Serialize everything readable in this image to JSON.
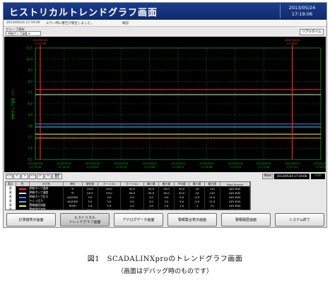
{
  "window": {
    "title": "ヒストリカルトレンドグラフ画面",
    "date": "2013/05/24",
    "time": "17:19:06"
  },
  "message_bar": {
    "timestamp": "2013/05/24 17:19:06",
    "message": "エラー時に警告が発生しました。",
    "status": "確認"
  },
  "selector": {
    "label": "グループ選択",
    "value": "供給ポンプ温度",
    "realtime_button": "リアルタイム"
  },
  "chart_data": {
    "type": "line",
    "title": "",
    "y_axis_label": "供給ポンプ温度（℃）",
    "y_ticks": [
      "11.5",
      "10.4",
      "9.3",
      "8.2",
      "7.1",
      "6.0",
      "4.9",
      "3.8",
      "2.7",
      "1.6",
      "0.5"
    ],
    "x_ticks": [
      {
        "date": "2013/05/24",
        "time": "17:14:08"
      },
      {
        "date": "2013/05/24",
        "time": "17:14:33"
      },
      {
        "date": "2013/05/24",
        "time": "17:14:58"
      },
      {
        "date": "2013/05/24",
        "time": "17:15:23"
      },
      {
        "date": "2013/05/24",
        "time": "17:15:48"
      },
      {
        "date": "2013/05/24",
        "time": "17:16:13"
      },
      {
        "date": "2013/05/24",
        "time": "17:16:38"
      },
      {
        "date": "2013/05/24",
        "time": "17:17:03"
      },
      {
        "date": "2013/05/24",
        "time": "17:17:28"
      },
      {
        "date": "2013/05/24",
        "time": "17:17:53"
      },
      {
        "date": "2013/05/24",
        "time": "17:18:18"
      }
    ],
    "cursor_labels": [
      {
        "date": "2013/05/24",
        "time": "17:14:08"
      },
      {
        "date": "2013/05/24",
        "time": "17:18:22"
      }
    ],
    "series": [
      {
        "color": "#ff3030",
        "value": 7.4
      },
      {
        "color": "#e8e8e8",
        "value": 6.9
      },
      {
        "color": "#7070ff",
        "value": 4.0
      },
      {
        "color": "#ffff30",
        "value": 3.0
      },
      {
        "color": "#30c8ff",
        "value": 3.7
      },
      {
        "color": "#ff8c00",
        "value": 2.6
      }
    ],
    "ylim": [
      0.5,
      11.5
    ],
    "grid": true,
    "cursors": [
      0.0,
      0.9
    ]
  },
  "nav": {
    "buttons": [
      "<<",
      "<",
      ">",
      ">>",
      "|<",
      ">|",
      "最新\n表示"
    ],
    "now_label": "Now",
    "now_value": "2013/05/24 17:19:06",
    "scale_value": "30秒"
  },
  "table": {
    "headers": [
      "表示",
      "色",
      "タグ名",
      "単位",
      "現在値",
      "カーソル1",
      "カーソル2",
      "最小値",
      "最大値",
      "平均値",
      "最小値",
      "最大値",
      "Data Source"
    ],
    "rows": [
      {
        "show": "表",
        "color": "#ff3030",
        "tag": "供給ポンプ温度",
        "unit": "℃",
        "cells": [
          "20.0",
          "20.0",
          "20.0",
          "20.0",
          "20.0",
          "20.0",
          "-10",
          "110"
        ],
        "source": "AZ1.R02"
      },
      {
        "show": "表",
        "color": "#e8e8e8",
        "tag": "供給ポンプ温度",
        "unit": "℃",
        "cells": [
          "20.0",
          "20.0",
          "20.0",
          "20.0",
          "20.0",
          "20.0",
          "-10",
          "110"
        ],
        "source": "AZ1.R02"
      },
      {
        "show": "表",
        "color": "#7070ff",
        "tag": "供給ポンプ圧力",
        "unit": "kG/CM2",
        "cells": [
          "3.0",
          "3.0",
          "3.0",
          "3.0",
          "3.0",
          "3.0",
          "-0.5",
          "11.5"
        ],
        "source": "AZ1.R03"
      },
      {
        "show": "表",
        "color": "#30c8ff",
        "tag": "ドレン圧力",
        "unit": "kG/CM2",
        "cells": [
          "3.0",
          "3.0",
          "3.0",
          "3.0",
          "3.0",
          "3.0",
          "-0.5",
          "11.5"
        ],
        "source": "AZ1.R03"
      },
      {
        "show": "表",
        "color": "#ffff30",
        "tag": "警報器用流量",
        "unit": "M3/H",
        "cells": [
          "1.0",
          "1.0",
          "1.0",
          "1.0",
          "1.0",
          "1.0",
          "-1",
          "11"
        ],
        "source": "AZ1.R04"
      },
      {
        "show": "表",
        "color": "#ff8c00",
        "tag": "警報器用流量",
        "unit": "kG",
        "cells": [
          "72.0",
          "0.0",
          "70.0",
          "0.0",
          "70.0",
          "24.0",
          "0",
          "1000"
        ],
        "source": "AZ1.R07"
      }
    ]
  },
  "function_buttons": [
    "計測値表示画面",
    "ヒストリカル\nトレンドグラフ画面",
    "アナログデータ画面",
    "警報集合表示画面",
    "警報履歴画面",
    "システム終了"
  ],
  "caption": {
    "line1": "図1　SCADALINXproのトレンドグラフ画面",
    "line2": "（画面はデバッグ時のものです）"
  }
}
